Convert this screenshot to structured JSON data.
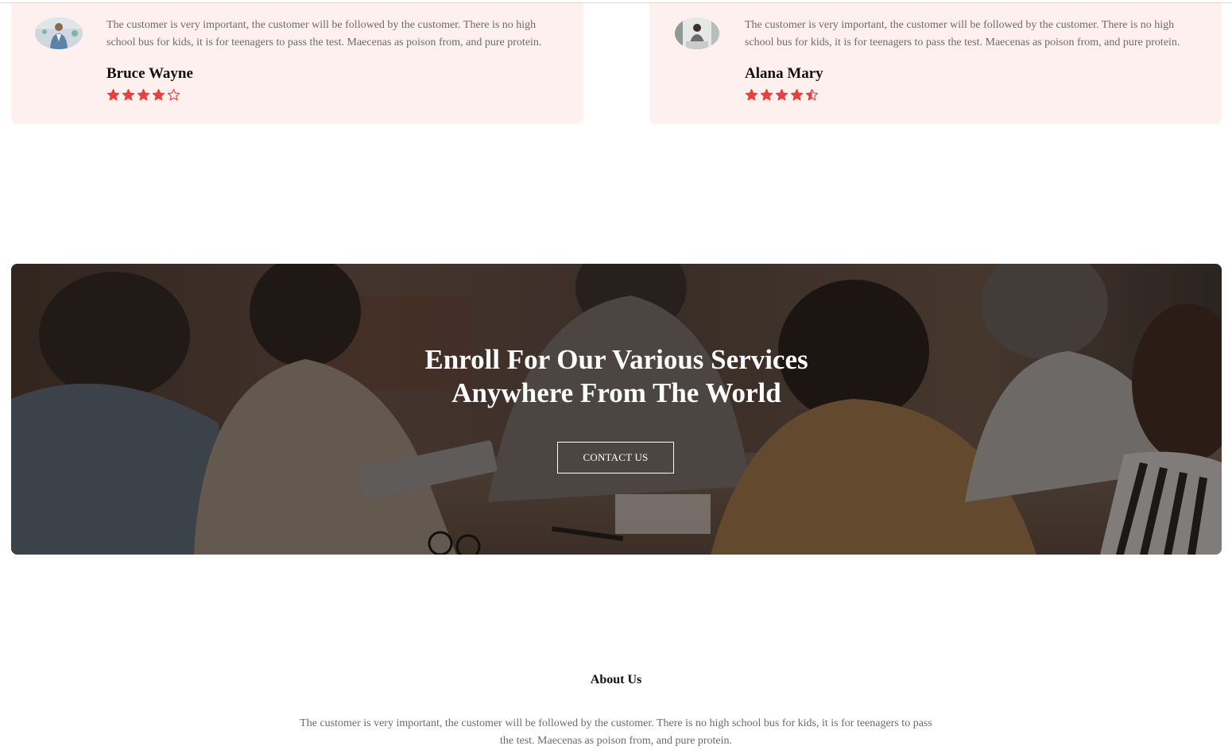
{
  "testimonials": [
    {
      "quote": "The customer is very important, the customer will be followed by the customer. There is no high school bus for kids, it is for teenagers to pass the test. Maecenas as poison from, and pure protein.",
      "name": "Bruce Wayne",
      "rating": 4,
      "rating_max": 5
    },
    {
      "quote": "The customer is very important, the customer will be followed by the customer. There is no high school bus for kids, it is for teenagers to pass the test. Maecenas as poison from, and pure protein.",
      "name": "Alana Mary",
      "rating": 4.5,
      "rating_max": 5
    }
  ],
  "banner": {
    "title_line1": "Enroll For Our Various Services",
    "title_line2": "Anywhere From The World",
    "button_label": "CONTACT US"
  },
  "about": {
    "title": "About Us",
    "text": "The customer is very important, the customer will be followed by the customer. There is no high school bus for kids, it is for teenagers to pass the test. Maecenas as poison from, and pure protein."
  },
  "colors": {
    "card_bg": "#fff0f0",
    "star": "#e8413a",
    "body_text": "#6b6b6b",
    "heading_text": "#111111"
  },
  "icons": {
    "star_full": "star-icon",
    "star_half": "star-half-icon",
    "star_empty": "star-outline-icon"
  }
}
